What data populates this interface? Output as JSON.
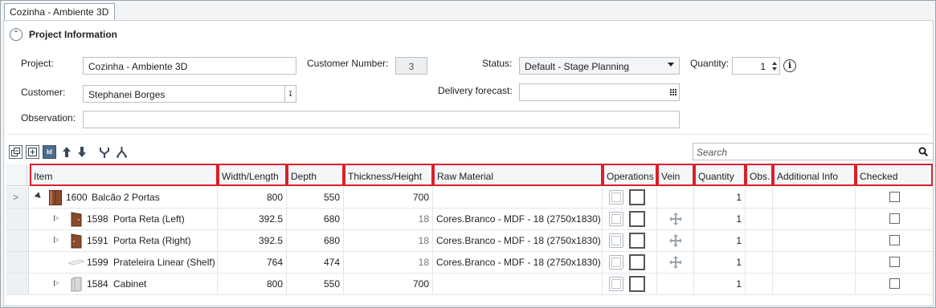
{
  "tab": {
    "title": "Cozinha - Ambiente 3D"
  },
  "project_info": {
    "title": "Project Information",
    "project_label": "Project:",
    "project_value": "Cozinha - Ambiente 3D",
    "customer_number_label": "Customer Number:",
    "customer_number_value": "3",
    "status_label": "Status:",
    "status_value": "Default - Stage Planning",
    "quantity_label": "Quantity:",
    "quantity_value": "1",
    "customer_label": "Customer:",
    "customer_value": "Stephanei Borges",
    "delivery_label": "Delivery forecast:",
    "delivery_value": "",
    "observation_label": "Observation:",
    "observation_value": ""
  },
  "toolbar": {
    "buttons": [
      "collapse-all-icon",
      "expand-all-icon",
      "id-toggle-icon",
      "move-up-icon",
      "move-down-icon",
      "merge-icon",
      "split-icon"
    ],
    "id_label": "Id",
    "search_placeholder": "Search"
  },
  "grid": {
    "columns": [
      "Item",
      "Width/Length",
      "Depth",
      "Thickness/Height",
      "Raw Material",
      "Operations",
      "Vein",
      "Quantity",
      "Obs.",
      "Additional Info",
      "Checked"
    ],
    "rows": [
      {
        "id": "1600",
        "name": "Balcão 2 Portas",
        "width": "800",
        "depth": "550",
        "thickness": "700",
        "material": "",
        "vein": false,
        "quantity": "1",
        "checked": false
      },
      {
        "id": "1598",
        "name": "Porta Reta (Left)",
        "width": "392.5",
        "depth": "680",
        "thickness": "18",
        "material": "Cores.Branco - MDF - 18 (2750x1830)",
        "vein": true,
        "quantity": "1",
        "checked": false
      },
      {
        "id": "1591",
        "name": "Porta Reta (Right)",
        "width": "392.5",
        "depth": "680",
        "thickness": "18",
        "material": "Cores.Branco - MDF - 18 (2750x1830)",
        "vein": true,
        "quantity": "1",
        "checked": false
      },
      {
        "id": "1599",
        "name": "Prateleira Linear (Shelf)",
        "width": "764",
        "depth": "474",
        "thickness": "18",
        "material": "Cores.Branco - MDF - 18 (2750x1830)",
        "vein": true,
        "quantity": "1",
        "checked": false
      },
      {
        "id": "1584",
        "name": "Cabinet",
        "width": "800",
        "depth": "550",
        "thickness": "700",
        "material": "",
        "vein": false,
        "quantity": "1",
        "checked": false
      }
    ]
  },
  "colors": {
    "highlight": "#d9202a",
    "id_button": "#4e6b8e",
    "wood": "#8a4b2b"
  }
}
